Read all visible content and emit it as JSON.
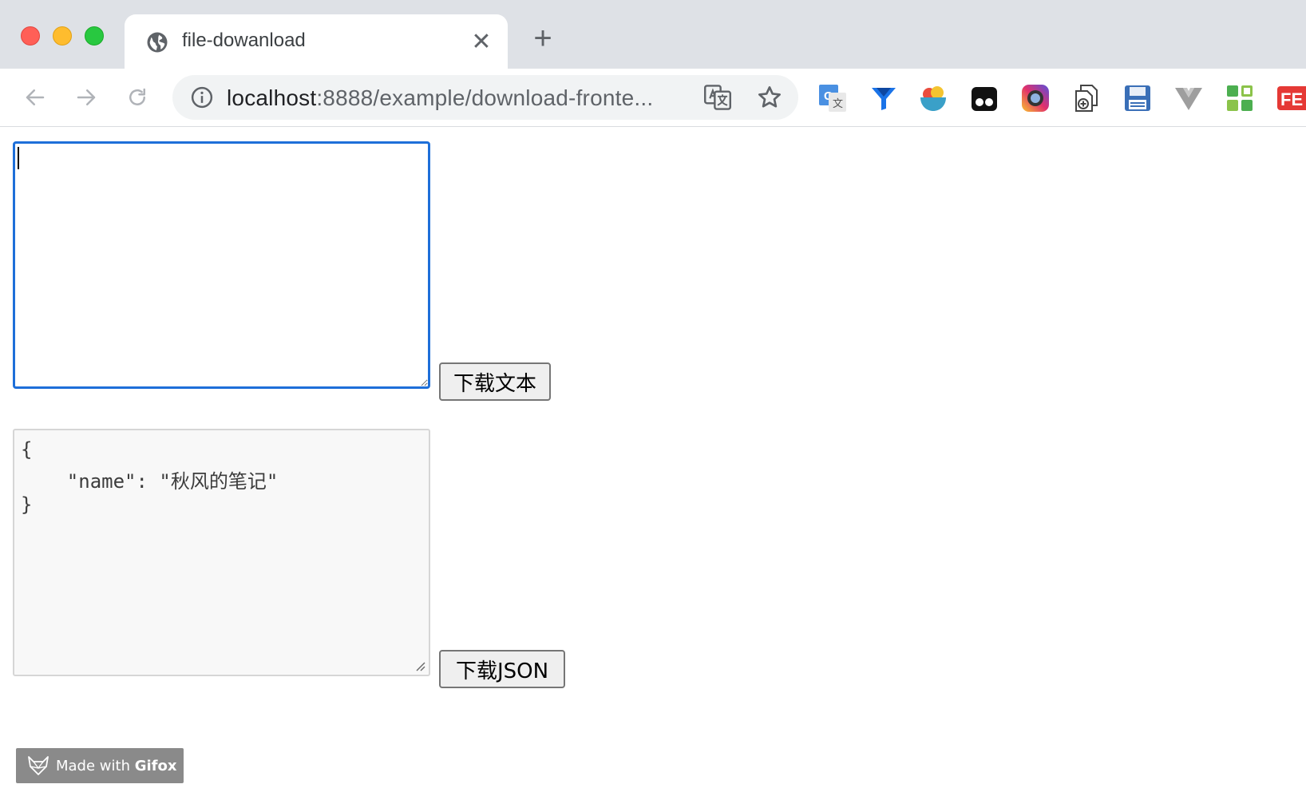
{
  "browser": {
    "tab": {
      "title": "file-dowanload",
      "favicon": "globe-icon",
      "close_glyph": "✕"
    },
    "new_tab_glyph": "+",
    "omnibox": {
      "url_host": "localhost",
      "url_rest": ":8888/example/download-fronte..."
    },
    "extensions": [
      "google-translate-extension-icon",
      "vue-funnel-extension-icon",
      "colorful-bowl-extension-icon",
      "dark-mask-extension-icon",
      "instagram-camera-extension-icon",
      "add-document-extension-icon",
      "save-disk-extension-icon",
      "vue-devtools-extension-icon",
      "green-grid-extension-icon",
      "fe-helper-extension-icon"
    ],
    "colors": {
      "accent": "#1e6fd9",
      "tabbar": "#dee1e6"
    }
  },
  "page": {
    "text_input": {
      "value": "",
      "placeholder": ""
    },
    "download_text_button": "下载文本",
    "json_input": {
      "lines": [
        "{",
        "    \"name\": \"秋风的笔记\"",
        "}"
      ]
    },
    "download_json_button": "下载JSON"
  },
  "watermark": {
    "prefix": "Made with ",
    "brand": "Gifox"
  }
}
